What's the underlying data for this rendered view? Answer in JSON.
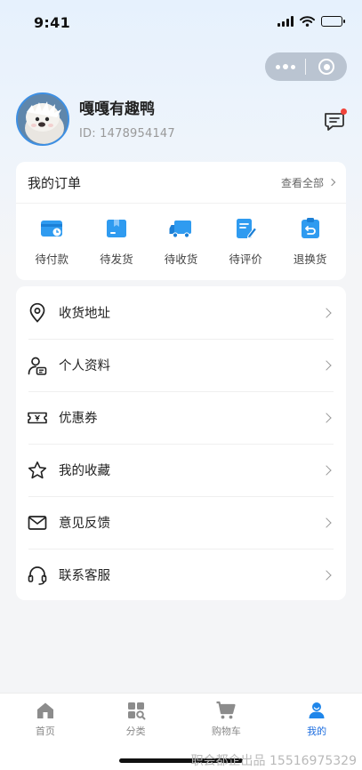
{
  "status_bar": {
    "time": "9:41"
  },
  "profile": {
    "name": "嘎嘎有趣鸭",
    "id_text": "ID: 1478954147",
    "has_unread_message": true
  },
  "orders": {
    "title": "我的订单",
    "view_all": "查看全部",
    "items": [
      {
        "label": "待付款",
        "icon": "wallet-card-icon"
      },
      {
        "label": "待发货",
        "icon": "package-box-icon"
      },
      {
        "label": "待收货",
        "icon": "delivery-truck-icon"
      },
      {
        "label": "待评价",
        "icon": "review-pen-icon"
      },
      {
        "label": "退换货",
        "icon": "return-clipboard-icon"
      }
    ]
  },
  "menu": {
    "items": [
      {
        "label": "收货地址",
        "icon": "location-pin-icon"
      },
      {
        "label": "个人资料",
        "icon": "user-profile-icon"
      },
      {
        "label": "优惠券",
        "icon": "coupon-ticket-icon"
      },
      {
        "label": "我的收藏",
        "icon": "star-icon"
      },
      {
        "label": "意见反馈",
        "icon": "mail-icon"
      },
      {
        "label": "联系客服",
        "icon": "headset-icon"
      }
    ]
  },
  "tabbar": {
    "items": [
      {
        "label": "首页",
        "icon": "home-icon",
        "active": false
      },
      {
        "label": "分类",
        "icon": "category-grid-icon",
        "active": false
      },
      {
        "label": "购物车",
        "icon": "cart-icon",
        "active": false
      },
      {
        "label": "我的",
        "icon": "user-icon",
        "active": true
      }
    ]
  },
  "colors": {
    "accent_blue": "#1f6fe0",
    "icon_blue": "#2f9bf0",
    "badge_red": "#f0433a",
    "page_bg": "#f4f5f7"
  },
  "watermark": "职会都企出品 15516975329"
}
